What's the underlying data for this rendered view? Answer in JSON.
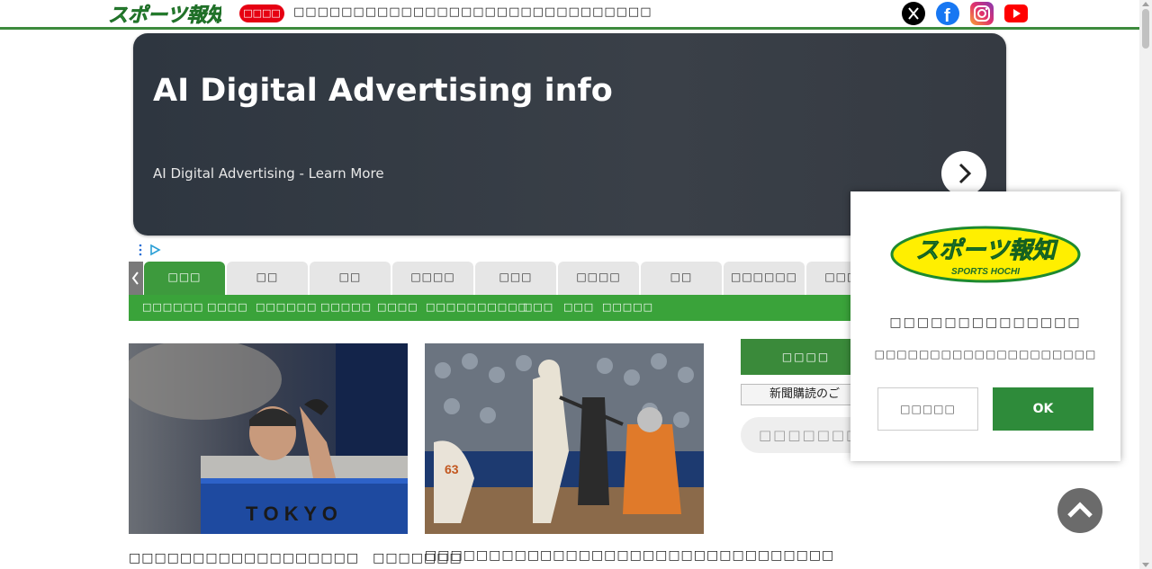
{
  "header": {
    "logo_text": "スポーツ報知",
    "breaking_badge": "□□□□",
    "breaking_text": "□□□□□□□□□□□□□□□□□□□□□□□□□□□□□□"
  },
  "social": [
    "x-icon",
    "facebook-icon",
    "instagram-icon",
    "youtube-icon"
  ],
  "ad": {
    "title": "AI Digital Advertising info",
    "subtitle": "AI Digital Advertising - Learn More"
  },
  "tabs": [
    "□□□",
    "□□",
    "□□",
    "□□□□",
    "□□□",
    "□□□□",
    "□□",
    "□□□□□□",
    "□□□□"
  ],
  "subnav": [
    "□□□□□□",
    "□□□□",
    "□□□□□□",
    "□□□□□",
    "□□□□",
    "□□□□□□□□□□",
    "□□□",
    "□□□",
    "□□□□□"
  ],
  "articles": [
    {
      "title": "□□□□□□□□□□□□□□□□□□　□□□□□□□"
    },
    {
      "title": "□□□□□□□□□□□□□□□□□□□□□□□□□□□□□□□□"
    }
  ],
  "sidebar": {
    "green_button": "□□□□",
    "subscription": "新聞購読のご",
    "search_placeholder": "□□□□□□□□□□"
  },
  "popup": {
    "logo_main": "スポーツ報知",
    "logo_sub": "SPORTS HOCHI",
    "title": "□□□□□□□□□□□□□□",
    "body": "□□□□□□□□□□□□□□□□□□□□",
    "cancel": "□□□□□",
    "ok": "OK"
  },
  "colors": {
    "brand_green": "#3d9a3d",
    "breaking_red": "#e60012",
    "logo_yellow": "#ffef00"
  }
}
